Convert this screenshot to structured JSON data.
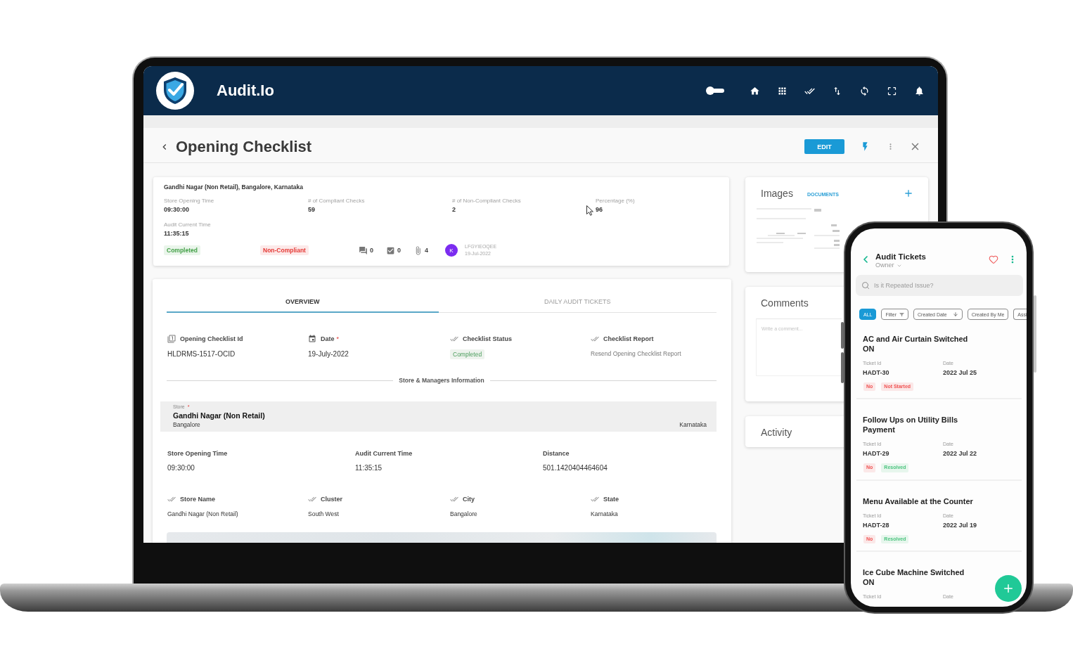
{
  "laptop": {
    "app_bar": {
      "title": "Audit.Io"
    },
    "page_header": {
      "title": "Opening Checklist",
      "edit_button": "EDIT"
    },
    "summary": {
      "heading": "Gandhi Nagar (Non Retail), Bangalore, Karnataka",
      "stats": [
        {
          "label": "Store Opening Time",
          "value": "09:30:00"
        },
        {
          "label": "# of Compliant Checks",
          "value": "59"
        },
        {
          "label": "# of Non-Compliant Checks",
          "value": "2"
        },
        {
          "label": "Percentage (%)",
          "value": "96"
        },
        {
          "label": "Audit Current Time",
          "value": "11:35:15"
        }
      ],
      "tags": [
        {
          "label": "Completed",
          "color": "#43a047"
        },
        {
          "label": "Non-Compliant",
          "color": "#e53935"
        }
      ],
      "counters": [
        {
          "kind": "comments",
          "value": "0"
        },
        {
          "kind": "tasks",
          "value": "0"
        },
        {
          "kind": "attachments",
          "value": "4"
        }
      ],
      "author": {
        "initial": "K",
        "name": "LFGYIEOQEE",
        "date": "19-Jul-2022"
      }
    },
    "tabs": [
      {
        "label": "OVERVIEW",
        "selected": true
      },
      {
        "label": "DAILY AUDIT TICKETS",
        "selected": false
      }
    ],
    "overview": {
      "fields": [
        {
          "kind": "id",
          "label": "Opening Checklist Id",
          "value": "HLDRMS-1517-OCID"
        },
        {
          "kind": "date",
          "label": "Date",
          "marker": "*",
          "value": "19-July-2022"
        },
        {
          "kind": "status",
          "label": "Checklist Status",
          "value": "Completed"
        },
        {
          "kind": "link",
          "label": "Checklist Report",
          "value": "Resend Opening Checklist Report"
        }
      ],
      "section_title": "Store & Managers Information",
      "store": {
        "label": "Store",
        "marker": "*",
        "name": "Gandhi Nagar (Non Retail)",
        "city": "Bangalore",
        "state": "Karnataka"
      },
      "times": [
        {
          "label": "Store Opening Time",
          "value": "09:30:00"
        },
        {
          "label": "Audit Current Time",
          "value": "11:35:15"
        },
        {
          "label": "Distance",
          "value": "501.1420404464604"
        }
      ],
      "details": [
        {
          "label": "Store Name",
          "value": "Gandhi Nagar (Non Retail)"
        },
        {
          "label": "Cluster",
          "value": "South West"
        },
        {
          "label": "City",
          "value": "Bangalore"
        },
        {
          "label": "State",
          "value": "Karnataka"
        }
      ]
    },
    "side_panels": [
      {
        "kind": "images",
        "title": "Images",
        "tab": "DOCUMENTS"
      },
      {
        "kind": "comments",
        "title": "Comments",
        "placeholder": "Write a comment..."
      },
      {
        "kind": "activity",
        "title": "Activity"
      }
    ]
  },
  "phone": {
    "header": {
      "title": "Audit Tickets",
      "subtitle": "Owner"
    },
    "search": {
      "placeholder": "Is it Repeated Issue?"
    },
    "chips": [
      {
        "kind": "plain",
        "label": "ALL",
        "selected": true
      },
      {
        "kind": "filter",
        "label": "Filter",
        "selected": false
      },
      {
        "kind": "sort",
        "label": "Created Date",
        "selected": false
      },
      {
        "kind": "plain",
        "label": "Created By Me",
        "selected": false
      },
      {
        "kind": "plain",
        "label": "Assi",
        "selected": false
      }
    ],
    "tickets": [
      {
        "title": "AC and Air Curtain Switched ON",
        "id_label": "Ticket Id",
        "id": "HADT-30",
        "date_label": "Date",
        "date": "2022 Jul 25",
        "tags": [
          {
            "label": "No",
            "color": "#f05252"
          },
          {
            "label": "Not Started",
            "color": "#f05252"
          }
        ]
      },
      {
        "title": "Follow Ups on Utility Bills Payment",
        "id_label": "Ticket Id",
        "id": "HADT-29",
        "date_label": "Date",
        "date": "2022 Jul 22",
        "tags": [
          {
            "label": "No",
            "color": "#f05252"
          },
          {
            "label": "Resolved",
            "color": "#4cc47f"
          }
        ]
      },
      {
        "title": "Menu Available at the Counter",
        "id_label": "Ticket Id",
        "id": "HADT-28",
        "date_label": "Date",
        "date": "2022 Jul 19",
        "tags": [
          {
            "label": "No",
            "color": "#f05252"
          },
          {
            "label": "Resolved",
            "color": "#4cc47f"
          }
        ]
      },
      {
        "title": "Ice Cube Machine Switched ON",
        "id_label": "Ticket Id",
        "date_label": "Date"
      }
    ]
  }
}
